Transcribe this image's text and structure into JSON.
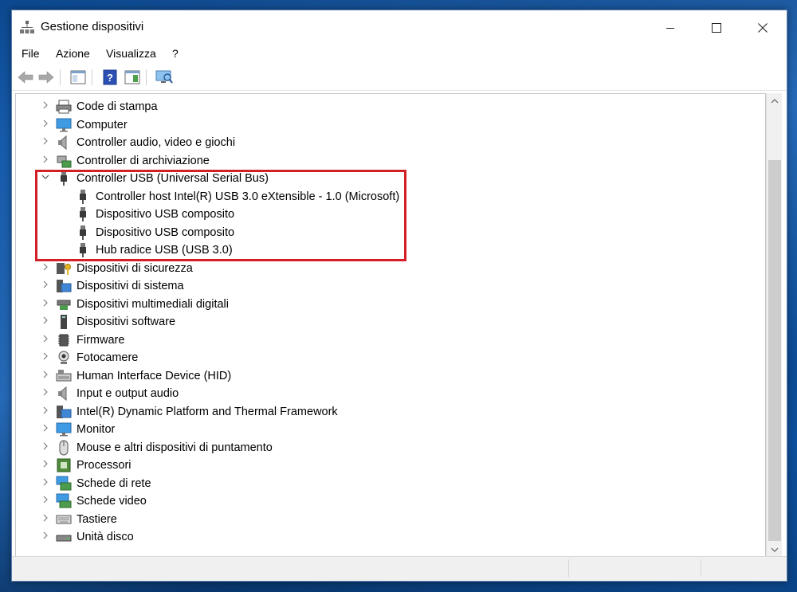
{
  "window": {
    "title": "Gestione dispositivi"
  },
  "menu": [
    "File",
    "Azione",
    "Visualizza",
    "?"
  ],
  "tree": [
    {
      "label": "Code di stampa",
      "icon": "printer-icon",
      "level": 0
    },
    {
      "label": "Computer",
      "icon": "monitor-icon",
      "level": 0
    },
    {
      "label": "Controller audio, video e giochi",
      "icon": "speaker-icon",
      "level": 0
    },
    {
      "label": "Controller di archiviazione",
      "icon": "storage-controller-icon",
      "level": 0
    },
    {
      "label": "Controller USB (Universal Serial Bus)",
      "icon": "usb-icon",
      "level": 0,
      "expanded": true
    },
    {
      "label": "Controller host Intel(R) USB 3.0 eXtensible - 1.0 (Microsoft)",
      "icon": "usb-icon",
      "level": 1
    },
    {
      "label": "Dispositivo USB composito",
      "icon": "usb-icon",
      "level": 1
    },
    {
      "label": "Dispositivo USB composito",
      "icon": "usb-icon",
      "level": 1
    },
    {
      "label": "Hub radice USB (USB 3.0)",
      "icon": "usb-icon",
      "level": 1
    },
    {
      "label": "Dispositivi di sicurezza",
      "icon": "security-key-icon",
      "level": 0
    },
    {
      "label": "Dispositivi di sistema",
      "icon": "system-folder-icon",
      "level": 0
    },
    {
      "label": "Dispositivi multimediali digitali",
      "icon": "media-device-icon",
      "level": 0
    },
    {
      "label": "Dispositivi software",
      "icon": "software-device-icon",
      "level": 0
    },
    {
      "label": "Firmware",
      "icon": "firmware-chip-icon",
      "level": 0
    },
    {
      "label": "Fotocamere",
      "icon": "webcam-icon",
      "level": 0
    },
    {
      "label": "Human Interface Device (HID)",
      "icon": "hid-icon",
      "level": 0
    },
    {
      "label": "Input e output audio",
      "icon": "speaker-icon",
      "level": 0
    },
    {
      "label": "Intel(R) Dynamic Platform and Thermal Framework",
      "icon": "system-folder-icon",
      "level": 0
    },
    {
      "label": "Monitor",
      "icon": "monitor-icon",
      "level": 0
    },
    {
      "label": "Mouse e altri dispositivi di puntamento",
      "icon": "mouse-icon",
      "level": 0
    },
    {
      "label": "Processori",
      "icon": "processor-icon",
      "level": 0
    },
    {
      "label": "Schede di rete",
      "icon": "network-adapter-icon",
      "level": 0
    },
    {
      "label": "Schede video",
      "icon": "display-adapter-icon",
      "level": 0
    },
    {
      "label": "Tastiere",
      "icon": "keyboard-icon",
      "level": 0
    },
    {
      "label": "Unità disco",
      "icon": "disk-drive-icon",
      "level": 0
    }
  ]
}
